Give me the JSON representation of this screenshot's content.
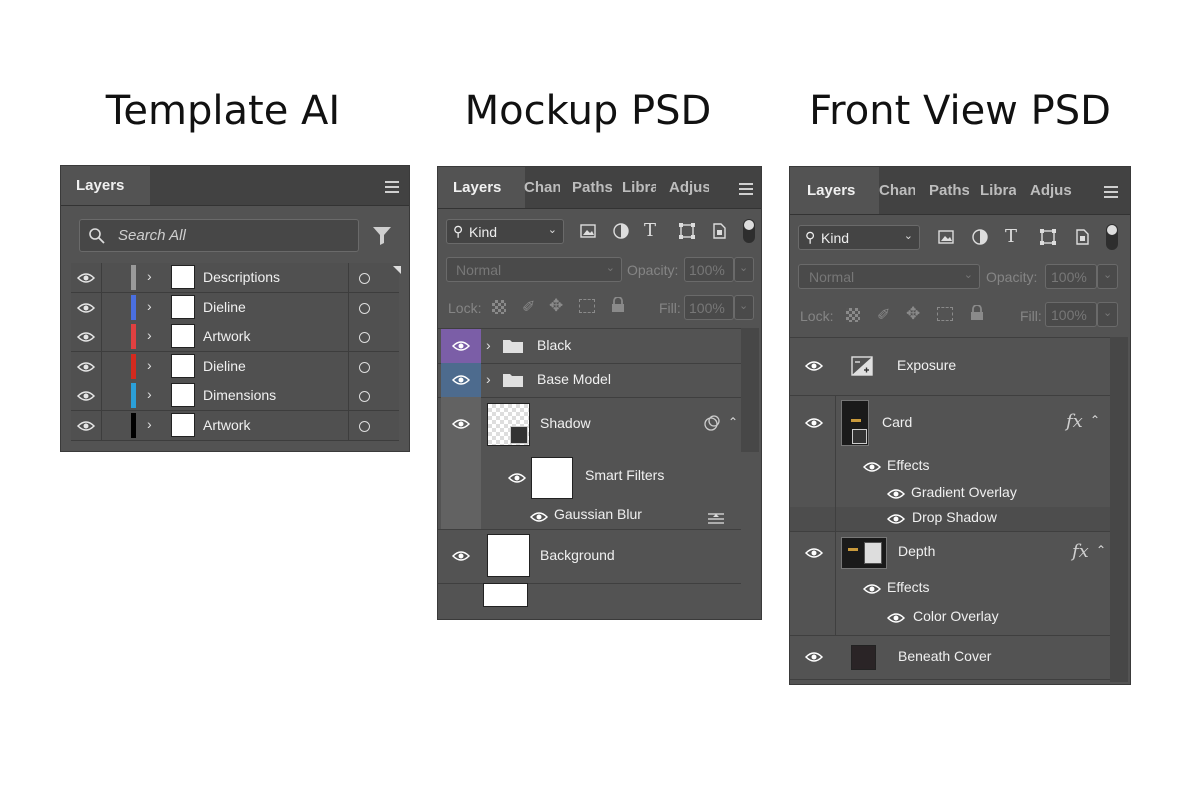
{
  "headings": {
    "left": "Template AI",
    "middle": "Mockup PSD",
    "right": "Front View PSD"
  },
  "ai_panel": {
    "tab": "Layers",
    "search_placeholder": "Search All",
    "layers": [
      {
        "name": "Descriptions",
        "color": "#9a9a9a"
      },
      {
        "name": "Dieline",
        "color": "#4a6fe0"
      },
      {
        "name": "Artwork",
        "color": "#e04040"
      },
      {
        "name": "Dieline",
        "color": "#d42a1e"
      },
      {
        "name": "Dimensions",
        "color": "#2b9fd8"
      },
      {
        "name": "Artwork",
        "color": "#000000"
      }
    ]
  },
  "mockup_panel": {
    "tabs": [
      "Layers",
      "Chan",
      "Paths",
      "Libra",
      "Adjus"
    ],
    "kind": "Kind",
    "blend_mode": "Normal",
    "opacity_label": "Opacity:",
    "opacity_value": "100%",
    "lock_label": "Lock:",
    "fill_label": "Fill:",
    "fill_value": "100%",
    "layers": {
      "black": "Black",
      "base_model": "Base Model",
      "shadow": "Shadow",
      "smart_filters": "Smart Filters",
      "gaussian_blur": "Gaussian Blur",
      "background": "Background"
    },
    "colors": {
      "black_eye": "#7b5ea7",
      "base_eye": "#4d6b8e"
    }
  },
  "front_panel": {
    "tabs": [
      "Layers",
      "Chan",
      "Paths",
      "Libra",
      "Adjus"
    ],
    "kind": "Kind",
    "blend_mode": "Normal",
    "opacity_label": "Opacity:",
    "opacity_value": "100%",
    "lock_label": "Lock:",
    "fill_label": "Fill:",
    "fill_value": "100%",
    "layers": {
      "exposure": "Exposure",
      "card": "Card",
      "effects_1": "Effects",
      "gradient_overlay": "Gradient Overlay",
      "drop_shadow": "Drop Shadow",
      "depth": "Depth",
      "effects_2": "Effects",
      "color_overlay": "Color Overlay",
      "beneath_cover": "Beneath Cover"
    },
    "fx": "fx"
  }
}
